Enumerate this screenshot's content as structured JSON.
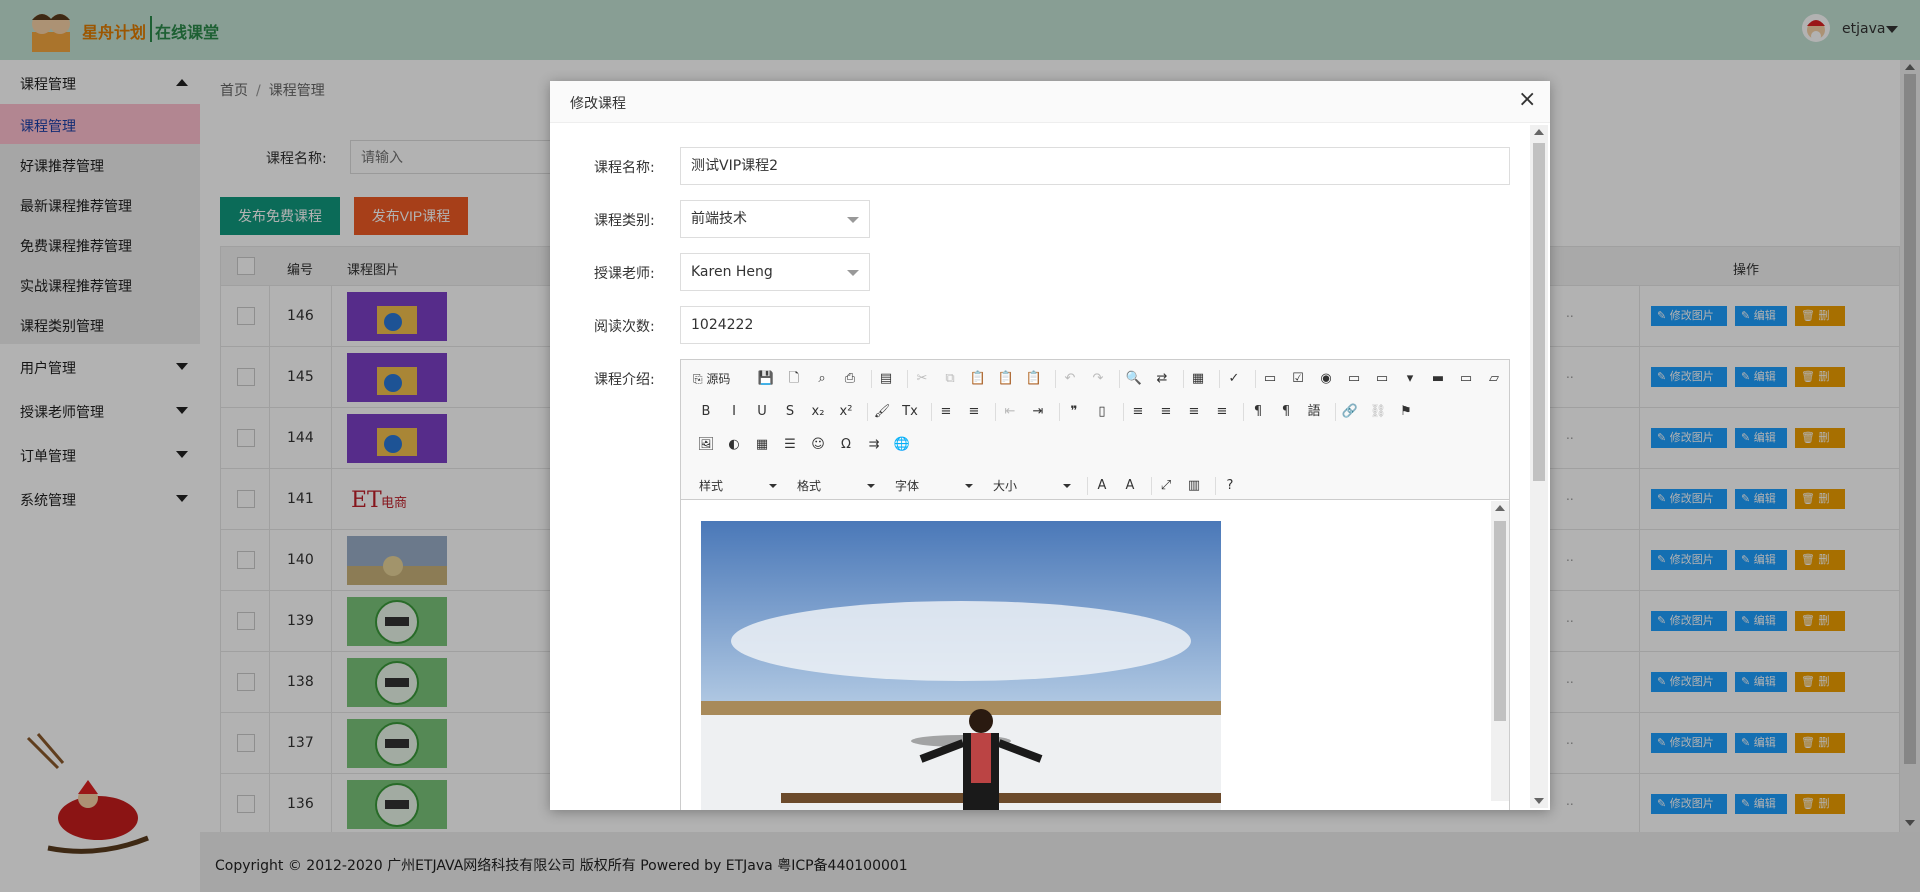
{
  "header": {
    "logo_text_1": "星舟计划",
    "logo_text_2": "在线课堂",
    "user_name": "etjava"
  },
  "sidebar": {
    "groups": [
      {
        "label": "课程管理",
        "expanded": true
      },
      {
        "label": "用户管理"
      },
      {
        "label": "授课老师管理"
      },
      {
        "label": "订单管理"
      },
      {
        "label": "系统管理"
      }
    ],
    "items": [
      {
        "label": "课程管理",
        "active": true
      },
      {
        "label": "好课推荐管理"
      },
      {
        "label": "最新课程推荐管理"
      },
      {
        "label": "免费课程推荐管理"
      },
      {
        "label": "实战课程推荐管理"
      },
      {
        "label": "课程类别管理"
      }
    ]
  },
  "breadcrumb": {
    "home": "首页",
    "current": "课程管理"
  },
  "filter": {
    "label": "课程名称:",
    "placeholder": "请输入"
  },
  "buttons": {
    "free": "发布免费课程",
    "vip": "发布VIP课程"
  },
  "table": {
    "columns": [
      "编号",
      "课程图片",
      "操作"
    ],
    "rows": [
      {
        "id": "146"
      },
      {
        "id": "145"
      },
      {
        "id": "144"
      },
      {
        "id": "141"
      },
      {
        "id": "140"
      },
      {
        "id": "139"
      },
      {
        "id": "138"
      },
      {
        "id": "137"
      },
      {
        "id": "136"
      }
    ],
    "actions": {
      "edit_pic": "修改图片",
      "edit": "编辑",
      "delete": "删除"
    }
  },
  "footer": {
    "text": "Copyright © 2012-2020 广州ETJAVA网络科技有限公司 版权所有 Powered by ETJava 粤ICP备440100001"
  },
  "modal": {
    "title": "修改课程",
    "fields": {
      "name_label": "课程名称:",
      "name_value": "测试VIP课程2",
      "category_label": "课程类别:",
      "category_value": "前端技术",
      "teacher_label": "授课老师:",
      "teacher_value": "Karen Heng",
      "views_label": "阅读次数:",
      "views_value": "1024222",
      "intro_label": "课程介绍:"
    },
    "editor": {
      "source_label": "源码",
      "combos": [
        "样式",
        "格式",
        "字体",
        "大小"
      ]
    }
  },
  "colors": {
    "header_bg": "#c3e2d4",
    "btn_free": "#119a7e",
    "btn_vip": "#ef5b25",
    "btn_blue": "#1e9fff",
    "btn_orange": "#f0a000",
    "active_menu": "#ffc0d0"
  }
}
